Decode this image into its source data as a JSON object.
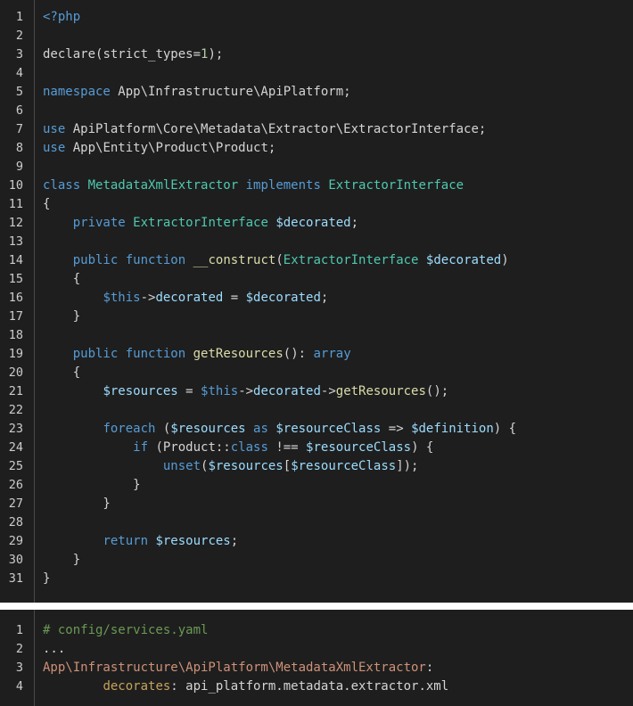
{
  "php_block": {
    "lines": [
      [
        [
          "k",
          "<?php"
        ]
      ],
      [],
      [
        [
          "p",
          "declare"
        ],
        [
          "p",
          "(strict_types="
        ],
        [
          "n",
          "1"
        ],
        [
          "p",
          ");"
        ]
      ],
      [],
      [
        [
          "k",
          "namespace"
        ],
        [
          "p",
          " App\\Infrastructure\\ApiPlatform;"
        ]
      ],
      [],
      [
        [
          "k",
          "use"
        ],
        [
          "p",
          " ApiPlatform\\Core\\Metadata\\Extractor\\ExtractorInterface;"
        ]
      ],
      [
        [
          "k",
          "use"
        ],
        [
          "p",
          " App\\Entity\\Product\\Product;"
        ]
      ],
      [],
      [
        [
          "k",
          "class"
        ],
        [
          "p",
          " "
        ],
        [
          "c",
          "MetadataXmlExtractor"
        ],
        [
          "p",
          " "
        ],
        [
          "k",
          "implements"
        ],
        [
          "p",
          " "
        ],
        [
          "c",
          "ExtractorInterface"
        ]
      ],
      [
        [
          "p",
          "{"
        ]
      ],
      [
        [
          "p",
          "    "
        ],
        [
          "k",
          "private"
        ],
        [
          "p",
          " "
        ],
        [
          "c",
          "ExtractorInterface"
        ],
        [
          "p",
          " "
        ],
        [
          "v",
          "$decorated"
        ],
        [
          "p",
          ";"
        ]
      ],
      [],
      [
        [
          "p",
          "    "
        ],
        [
          "k",
          "public"
        ],
        [
          "p",
          " "
        ],
        [
          "k",
          "function"
        ],
        [
          "p",
          " "
        ],
        [
          "f",
          "__construct"
        ],
        [
          "p",
          "("
        ],
        [
          "c",
          "ExtractorInterface"
        ],
        [
          "p",
          " "
        ],
        [
          "v",
          "$decorated"
        ],
        [
          "p",
          ")"
        ]
      ],
      [
        [
          "p",
          "    {"
        ]
      ],
      [
        [
          "p",
          "        "
        ],
        [
          "k",
          "$this"
        ],
        [
          "p",
          "->"
        ],
        [
          "v",
          "decorated"
        ],
        [
          "p",
          " = "
        ],
        [
          "v",
          "$decorated"
        ],
        [
          "p",
          ";"
        ]
      ],
      [
        [
          "p",
          "    }"
        ]
      ],
      [],
      [
        [
          "p",
          "    "
        ],
        [
          "k",
          "public"
        ],
        [
          "p",
          " "
        ],
        [
          "k",
          "function"
        ],
        [
          "p",
          " "
        ],
        [
          "f",
          "getResources"
        ],
        [
          "p",
          "(): "
        ],
        [
          "k",
          "array"
        ]
      ],
      [
        [
          "p",
          "    {"
        ]
      ],
      [
        [
          "p",
          "        "
        ],
        [
          "v",
          "$resources"
        ],
        [
          "p",
          " = "
        ],
        [
          "k",
          "$this"
        ],
        [
          "p",
          "->"
        ],
        [
          "v",
          "decorated"
        ],
        [
          "p",
          "->"
        ],
        [
          "f",
          "getResources"
        ],
        [
          "p",
          "();"
        ]
      ],
      [],
      [
        [
          "p",
          "        "
        ],
        [
          "k",
          "foreach"
        ],
        [
          "p",
          " ("
        ],
        [
          "v",
          "$resources"
        ],
        [
          "p",
          " "
        ],
        [
          "k",
          "as"
        ],
        [
          "p",
          " "
        ],
        [
          "v",
          "$resourceClass"
        ],
        [
          "p",
          " => "
        ],
        [
          "v",
          "$definition"
        ],
        [
          "p",
          ") {"
        ]
      ],
      [
        [
          "p",
          "            "
        ],
        [
          "k",
          "if"
        ],
        [
          "p",
          " (Product::"
        ],
        [
          "k",
          "class"
        ],
        [
          "p",
          " !== "
        ],
        [
          "v",
          "$resourceClass"
        ],
        [
          "p",
          ") {"
        ]
      ],
      [
        [
          "p",
          "                "
        ],
        [
          "k",
          "unset"
        ],
        [
          "p",
          "("
        ],
        [
          "v",
          "$resources"
        ],
        [
          "p",
          "["
        ],
        [
          "v",
          "$resourceClass"
        ],
        [
          "p",
          "]);"
        ]
      ],
      [
        [
          "p",
          "            }"
        ]
      ],
      [
        [
          "p",
          "        }"
        ]
      ],
      [],
      [
        [
          "p",
          "        "
        ],
        [
          "k",
          "return"
        ],
        [
          "p",
          " "
        ],
        [
          "v",
          "$resources"
        ],
        [
          "p",
          ";"
        ]
      ],
      [
        [
          "p",
          "    }"
        ]
      ],
      [
        [
          "p",
          "}"
        ]
      ]
    ]
  },
  "yaml_block": {
    "lines": [
      [
        [
          "cm",
          "# config/services.yaml"
        ]
      ],
      [
        [
          "p",
          "..."
        ]
      ],
      [
        [
          "y",
          "App\\Infrastructure\\ApiPlatform\\MetadataXmlExtractor"
        ],
        [
          "p",
          ":"
        ]
      ],
      [
        [
          "p",
          "        "
        ],
        [
          "yk",
          "decorates"
        ],
        [
          "p",
          ": api_platform.metadata.extractor.xml"
        ]
      ]
    ]
  }
}
